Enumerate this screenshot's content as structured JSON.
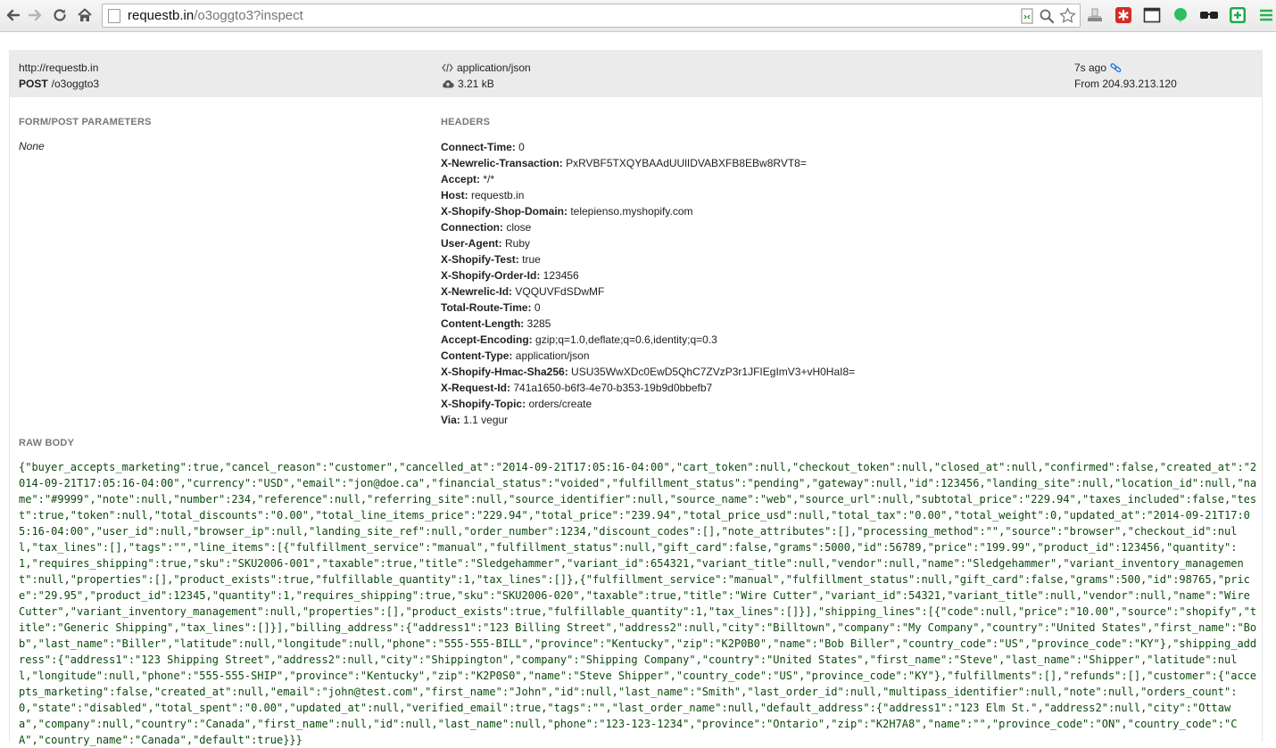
{
  "browser": {
    "url_host": "requestb.in",
    "url_path": "/o3oggto3?inspect",
    "icons": [
      "back-icon",
      "forward-icon",
      "reload-icon",
      "home-icon",
      "search-icon",
      "star-icon"
    ],
    "extensions": [
      "scale-icon",
      "lastpass-icon",
      "window-icon",
      "evernote-icon",
      "glasses-icon",
      "plus-square-icon",
      "menu-icon"
    ]
  },
  "summary": {
    "host": "http://requestb.in",
    "method": "POST",
    "path": "/o3oggto3",
    "content_type": "application/json",
    "size": "3.21 kB",
    "time_ago": "7s ago",
    "from": "From 204.93.213.120",
    "link_color": "#1a73e8"
  },
  "form": {
    "title": "FORM/POST PARAMETERS",
    "value": "None"
  },
  "headers": {
    "title": "HEADERS",
    "items": [
      {
        "key": "Connect-Time:",
        "value": "0"
      },
      {
        "key": "X-Newrelic-Transaction:",
        "value": "PxRVBF5TXQYBAAdUUlIDVABXFB8EBw8RVT8="
      },
      {
        "key": "Accept:",
        "value": "*/*"
      },
      {
        "key": "Host:",
        "value": "requestb.in"
      },
      {
        "key": "X-Shopify-Shop-Domain:",
        "value": "telepienso.myshopify.com"
      },
      {
        "key": "Connection:",
        "value": "close"
      },
      {
        "key": "User-Agent:",
        "value": "Ruby"
      },
      {
        "key": "X-Shopify-Test:",
        "value": "true"
      },
      {
        "key": "X-Shopify-Order-Id:",
        "value": "123456"
      },
      {
        "key": "X-Newrelic-Id:",
        "value": "VQQUVFdSDwMF"
      },
      {
        "key": "Total-Route-Time:",
        "value": "0"
      },
      {
        "key": "Content-Length:",
        "value": "3285"
      },
      {
        "key": "Accept-Encoding:",
        "value": "gzip;q=1.0,deflate;q=0.6,identity;q=0.3"
      },
      {
        "key": "Content-Type:",
        "value": "application/json"
      },
      {
        "key": "X-Shopify-Hmac-Sha256:",
        "value": "USU35WwXDc0EwD5QhC7ZVzP3r1JFIEgImV3+vH0HaI8="
      },
      {
        "key": "X-Request-Id:",
        "value": "741a1650-b6f3-4e70-b353-19b9d0bbefb7"
      },
      {
        "key": "X-Shopify-Topic:",
        "value": "orders/create"
      },
      {
        "key": "Via:",
        "value": "1.1 vegur"
      }
    ]
  },
  "raw": {
    "title": "RAW BODY",
    "body": "{\"buyer_accepts_marketing\":true,\"cancel_reason\":\"customer\",\"cancelled_at\":\"2014-09-21T17:05:16-04:00\",\"cart_token\":null,\"checkout_token\":null,\"closed_at\":null,\"confirmed\":false,\"created_at\":\"2014-09-21T17:05:16-04:00\",\"currency\":\"USD\",\"email\":\"jon@doe.ca\",\"financial_status\":\"voided\",\"fulfillment_status\":\"pending\",\"gateway\":null,\"id\":123456,\"landing_site\":null,\"location_id\":null,\"name\":\"#9999\",\"note\":null,\"number\":234,\"reference\":null,\"referring_site\":null,\"source_identifier\":null,\"source_name\":\"web\",\"source_url\":null,\"subtotal_price\":\"229.94\",\"taxes_included\":false,\"test\":true,\"token\":null,\"total_discounts\":\"0.00\",\"total_line_items_price\":\"229.94\",\"total_price\":\"239.94\",\"total_price_usd\":null,\"total_tax\":\"0.00\",\"total_weight\":0,\"updated_at\":\"2014-09-21T17:05:16-04:00\",\"user_id\":null,\"browser_ip\":null,\"landing_site_ref\":null,\"order_number\":1234,\"discount_codes\":[],\"note_attributes\":[],\"processing_method\":\"\",\"source\":\"browser\",\"checkout_id\":null,\"tax_lines\":[],\"tags\":\"\",\"line_items\":[{\"fulfillment_service\":\"manual\",\"fulfillment_status\":null,\"gift_card\":false,\"grams\":5000,\"id\":56789,\"price\":\"199.99\",\"product_id\":123456,\"quantity\":1,\"requires_shipping\":true,\"sku\":\"SKU2006-001\",\"taxable\":true,\"title\":\"Sledgehammer\",\"variant_id\":654321,\"variant_title\":null,\"vendor\":null,\"name\":\"Sledgehammer\",\"variant_inventory_management\":null,\"properties\":[],\"product_exists\":true,\"fulfillable_quantity\":1,\"tax_lines\":[]},{\"fulfillment_service\":\"manual\",\"fulfillment_status\":null,\"gift_card\":false,\"grams\":500,\"id\":98765,\"price\":\"29.95\",\"product_id\":12345,\"quantity\":1,\"requires_shipping\":true,\"sku\":\"SKU2006-020\",\"taxable\":true,\"title\":\"Wire Cutter\",\"variant_id\":54321,\"variant_title\":null,\"vendor\":null,\"name\":\"Wire Cutter\",\"variant_inventory_management\":null,\"properties\":[],\"product_exists\":true,\"fulfillable_quantity\":1,\"tax_lines\":[]}],\"shipping_lines\":[{\"code\":null,\"price\":\"10.00\",\"source\":\"shopify\",\"title\":\"Generic Shipping\",\"tax_lines\":[]}],\"billing_address\":{\"address1\":\"123 Billing Street\",\"address2\":null,\"city\":\"Billtown\",\"company\":\"My Company\",\"country\":\"United States\",\"first_name\":\"Bob\",\"last_name\":\"Biller\",\"latitude\":null,\"longitude\":null,\"phone\":\"555-555-BILL\",\"province\":\"Kentucky\",\"zip\":\"K2P0B0\",\"name\":\"Bob Biller\",\"country_code\":\"US\",\"province_code\":\"KY\"},\"shipping_address\":{\"address1\":\"123 Shipping Street\",\"address2\":null,\"city\":\"Shippington\",\"company\":\"Shipping Company\",\"country\":\"United States\",\"first_name\":\"Steve\",\"last_name\":\"Shipper\",\"latitude\":null,\"longitude\":null,\"phone\":\"555-555-SHIP\",\"province\":\"Kentucky\",\"zip\":\"K2P0S0\",\"name\":\"Steve Shipper\",\"country_code\":\"US\",\"province_code\":\"KY\"},\"fulfillments\":[],\"refunds\":[],\"customer\":{\"accepts_marketing\":false,\"created_at\":null,\"email\":\"john@test.com\",\"first_name\":\"John\",\"id\":null,\"last_name\":\"Smith\",\"last_order_id\":null,\"multipass_identifier\":null,\"note\":null,\"orders_count\":0,\"state\":\"disabled\",\"total_spent\":\"0.00\",\"updated_at\":null,\"verified_email\":true,\"tags\":\"\",\"last_order_name\":null,\"default_address\":{\"address1\":\"123 Elm St.\",\"address2\":null,\"city\":\"Ottawa\",\"company\":null,\"country\":\"Canada\",\"first_name\":null,\"id\":null,\"last_name\":null,\"phone\":\"123-123-1234\",\"province\":\"Ontario\",\"zip\":\"K2H7A8\",\"name\":\"\",\"province_code\":\"ON\",\"country_code\":\"CA\",\"country_name\":\"Canada\",\"default\":true}}}"
  }
}
